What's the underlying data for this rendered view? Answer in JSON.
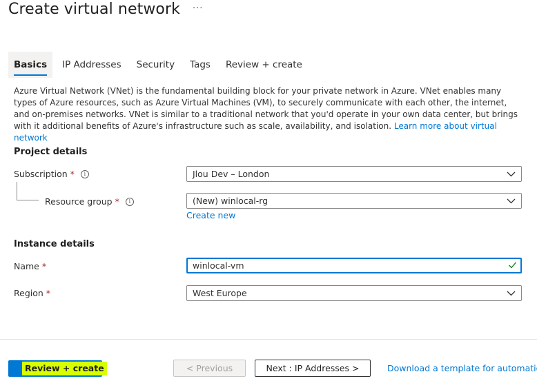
{
  "header": {
    "title": "Create virtual network",
    "more_icon": "more-icon"
  },
  "tabs": [
    {
      "label": "Basics",
      "active": true
    },
    {
      "label": "IP Addresses",
      "active": false
    },
    {
      "label": "Security",
      "active": false
    },
    {
      "label": "Tags",
      "active": false
    },
    {
      "label": "Review + create",
      "active": false
    }
  ],
  "description": {
    "text": "Azure Virtual Network (VNet) is the fundamental building block for your private network in Azure. VNet enables many types of Azure resources, such as Azure Virtual Machines (VM), to securely communicate with each other, the internet, and on-premises networks. VNet is similar to a traditional network that you'd operate in your own data center, but brings with it additional benefits of Azure's infrastructure such as scale, availability, and isolation.",
    "link": "Learn more about virtual network"
  },
  "project_details": {
    "title": "Project details",
    "subscription": {
      "label": "Subscription",
      "required": "*",
      "value": "Jlou Dev – London"
    },
    "resource_group": {
      "label": "Resource group",
      "required": "*",
      "value": "(New) winlocal-rg",
      "create_new": "Create new"
    }
  },
  "instance_details": {
    "title": "Instance details",
    "name": {
      "label": "Name",
      "required": "*",
      "value": "winlocal-vm"
    },
    "region": {
      "label": "Region",
      "required": "*",
      "value": "West Europe"
    }
  },
  "footer": {
    "review_create": "Review + create",
    "previous": "< Previous",
    "next": "Next : IP Addresses >",
    "download": "Download a template for automation"
  },
  "colors": {
    "accent": "#0078d4",
    "highlight": "#d8ff00",
    "required": "#a4262c",
    "valid_check": "#107c10"
  }
}
